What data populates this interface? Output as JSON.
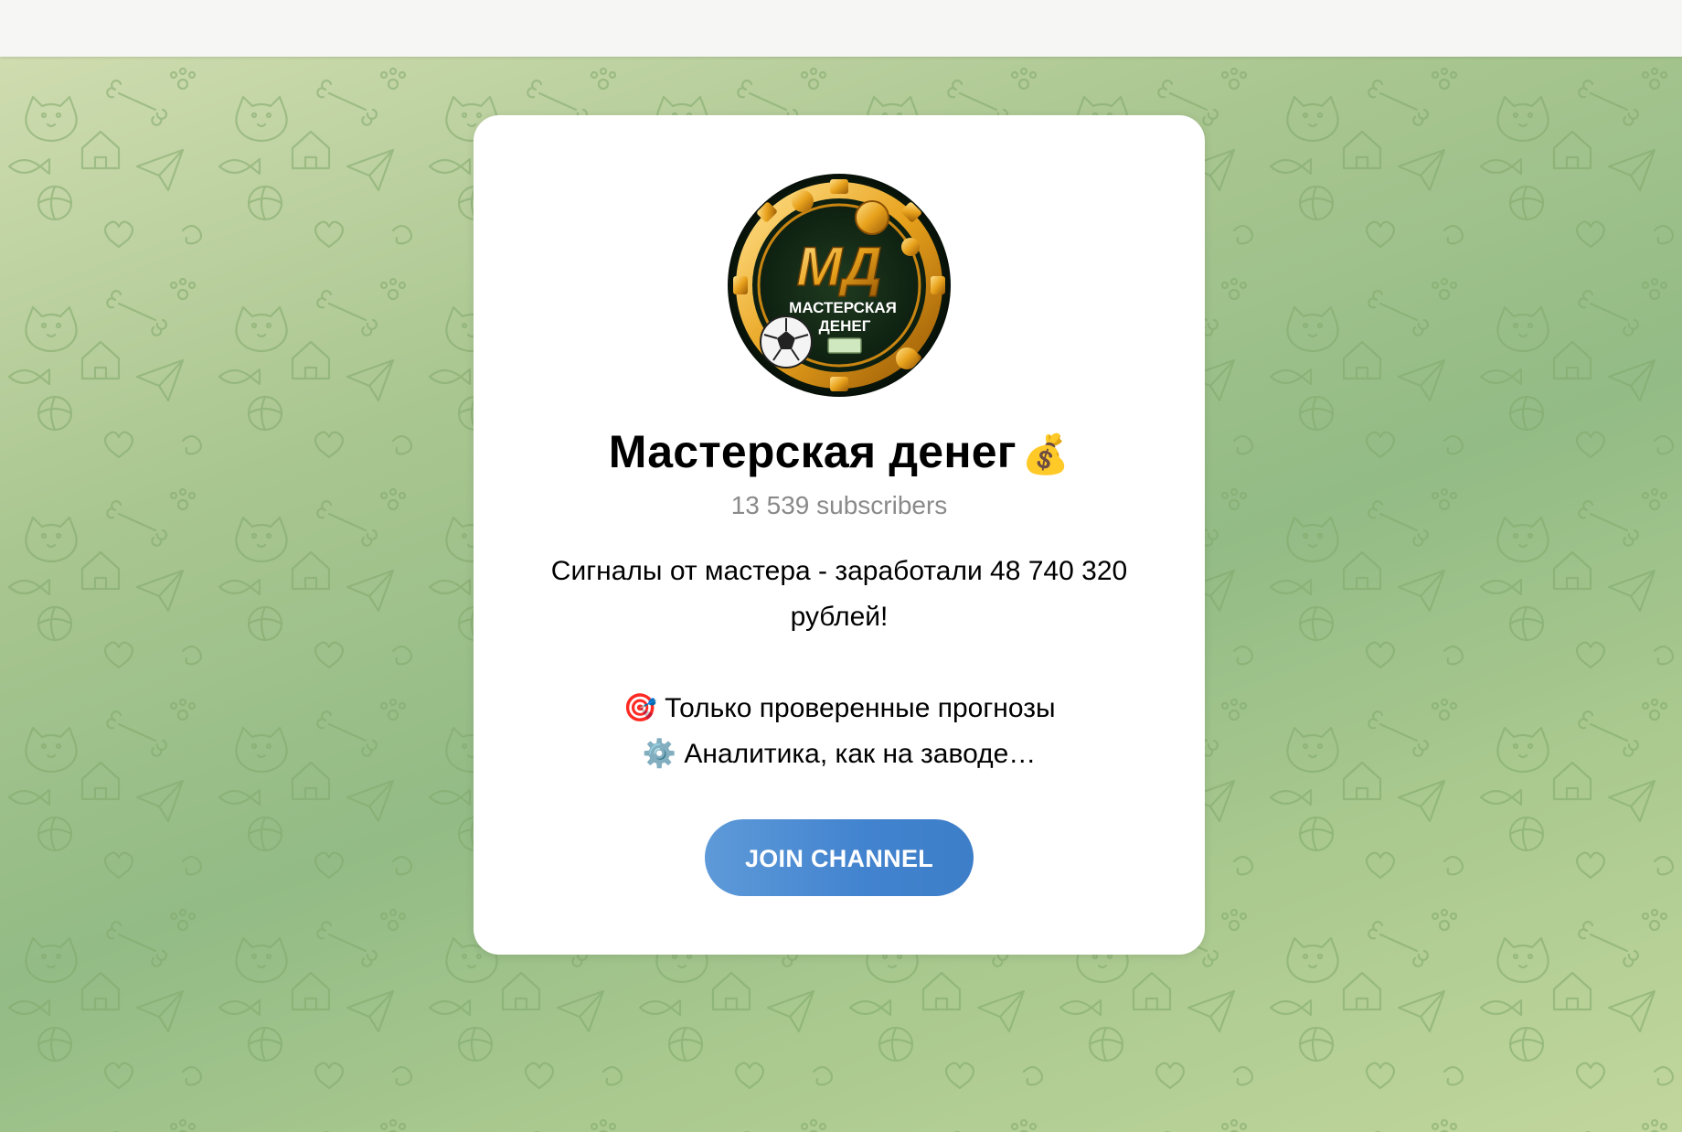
{
  "channel": {
    "title": "Мастерская денег",
    "title_emoji": "💰",
    "subscribers": "13 539 subscribers",
    "avatar": {
      "monogram": "МД",
      "line1": "МАСТЕРСКАЯ",
      "line2": "ДЕНЕГ"
    },
    "description": [
      "Сигналы от мастера - заработали 48 740 320",
      "рублей!",
      "",
      "🎯 Только проверенные прогнозы",
      "⚙️ Аналитика, как на заводе…"
    ]
  },
  "join_button": {
    "label": "JOIN CHANNEL",
    "color": "#4283cf"
  },
  "colors": {
    "background_green": "#a9c690",
    "card": "#ffffff",
    "top_bar": "#f6f7f4"
  }
}
